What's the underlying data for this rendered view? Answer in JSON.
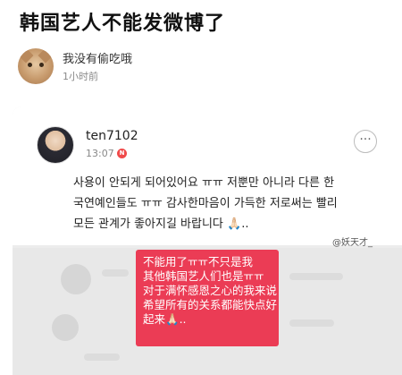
{
  "post": {
    "title": "韩国艺人不能发微博了",
    "author": "我没有偷吃哦",
    "time": "1小时前"
  },
  "embedded": {
    "username": "ten7102",
    "time": "13:07",
    "badge": "N",
    "more": "···",
    "text": "사용이 안되게 되어있어요 ㅠㅠ 저뿐만 아니라 다른 한국연예인들도 ㅠㅠ 감사한마음이 가득한 저로써는 빨리 모든 관계가 좋아지길 바랍니다 🙏🏻..",
    "watermark": "@妖天才_"
  },
  "translation": {
    "lines": [
      "不能用了ㅠㅠ不只是我",
      "其他韩国艺人们也是ㅠㅠ",
      "对于满怀感恩之心的我来说",
      "希望所有的关系都能快点好",
      "起来🙏🏻.."
    ]
  }
}
